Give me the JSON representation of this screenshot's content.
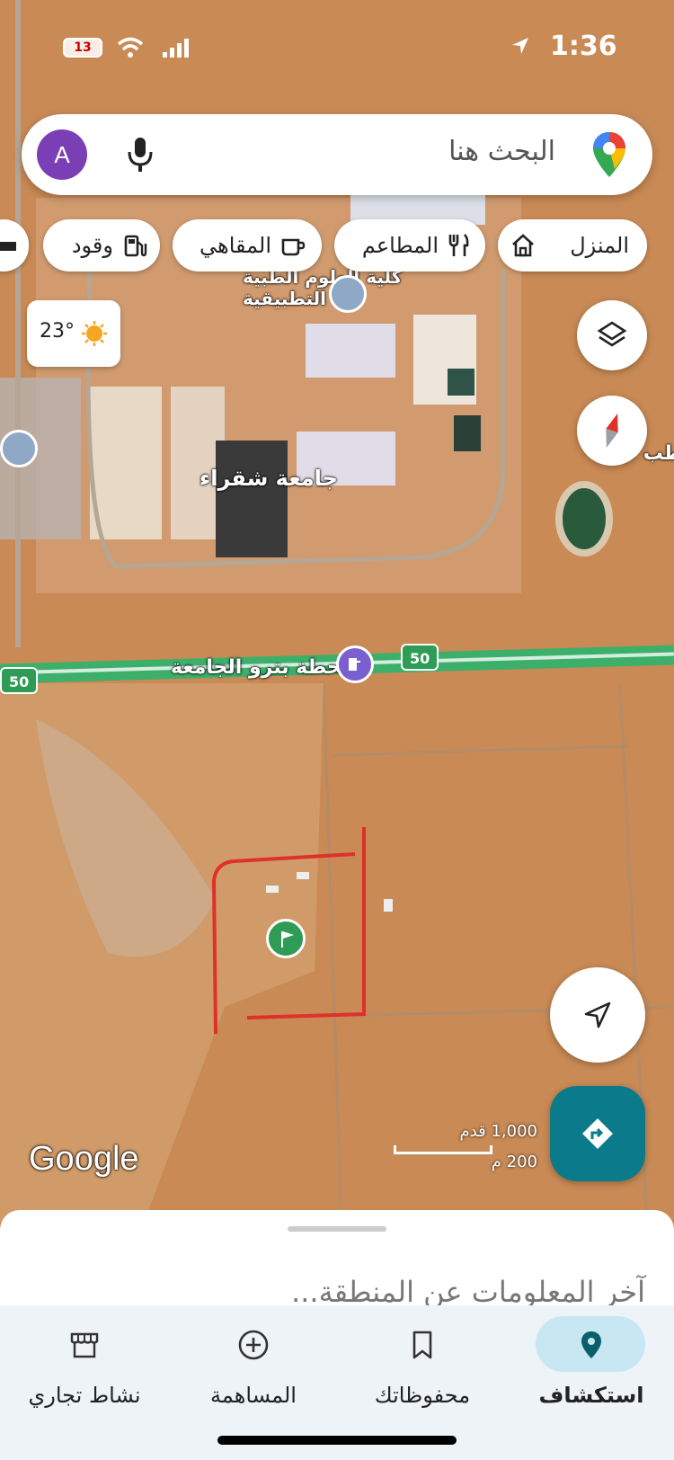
{
  "status_bar": {
    "time": "1:36",
    "battery": "13"
  },
  "search": {
    "avatar_letter": "A",
    "placeholder": "البحث هنا"
  },
  "chips": [
    {
      "label": "المنزل",
      "icon": "home-icon"
    },
    {
      "label": "المطاعم",
      "icon": "fork-knife-icon"
    },
    {
      "label": "المقاهي",
      "icon": "coffee-cup-icon"
    },
    {
      "label": "وقود",
      "icon": "fuel-pump-icon"
    }
  ],
  "weather": {
    "temp": "23°",
    "icon": "sun-icon"
  },
  "map_labels": {
    "university": "جامعة شقراء",
    "college_line1": "كلية العلوم الطبية",
    "college_line2": "التطبيقية",
    "gas_station": "محطة بترو الجامعة",
    "right_edge": "الطب ب",
    "route_shield": "50"
  },
  "map_attribution": "Google",
  "scale": {
    "feet": "1,000 قدم",
    "meters": "200 م"
  },
  "sheet": {
    "latest": "آخر المعلومات عن المنطقة..."
  },
  "nav": [
    {
      "label": "استكشاف",
      "icon": "location-pin-icon",
      "active": true
    },
    {
      "label": "محفوظاتك",
      "icon": "bookmark-icon",
      "active": false
    },
    {
      "label": "المساهمة",
      "icon": "add-circle-icon",
      "active": false
    },
    {
      "label": "نشاط تجاري",
      "icon": "storefront-icon",
      "active": false
    }
  ],
  "colors": {
    "accent": "#0b7a8a",
    "pin_green": "#2e9c55",
    "avatar": "#7b3fb5",
    "highway": "#3cb06a",
    "annotation": "#e0302a"
  }
}
